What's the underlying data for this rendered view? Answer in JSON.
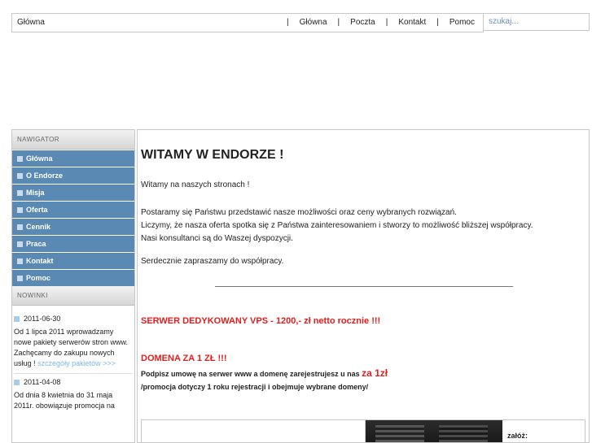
{
  "header": {
    "breadcrumb": "Główna",
    "nav": [
      "Główna",
      "Poczta",
      "Kontakt",
      "Pomoc"
    ],
    "search_placeholder": "szukaj..."
  },
  "sidebar": {
    "nav_title": "NAWIGATOR",
    "items": [
      "Główna",
      "O Endorze",
      "Misja",
      "Oferta",
      "Cennik",
      "Praca",
      "Kontakt",
      "Pomoc"
    ],
    "news_title": "NOWINKI",
    "news": [
      {
        "date": "2011-06-30",
        "text": "Od 1 lipca 2011 wprowadzamy nowe pakiety serwerów stron www. Zachęcamy do zakupu nowych usług !",
        "link": "szczegóły pakietów >>>"
      },
      {
        "date": "2011-04-08",
        "text": "Od dnia 8 kwietnia do 31 maja 2011r. obowiązuje promocja na"
      }
    ]
  },
  "main": {
    "title": "WITAMY W ENDORZE !",
    "intro": "Witamy na naszych stronach !",
    "para1": "Postaramy się Państwu przedstawić nasze możliwości oraz ceny wybranych rozwiązań.",
    "para2": "Liczymy, że nasza oferta spotka się z Państwa zainteresowaniem i stworzy to możliwość bliższej współpracy.",
    "para3": "Nasi konsultanci są do Waszej dyspozycji.",
    "closing": "Serdecznie zapraszamy do współpracy.",
    "promo1": "SERWER DEDYKOWANY VPS - 1200,- zł netto rocznie !!!",
    "promo2": "DOMENA ZA 1 ZŁ !!!",
    "promo2_line1_a": "Podpisz umowę na serwer www a domenę zarejestrujesz u nas",
    "promo2_line1_price": "za 1zł",
    "promo2_line2": "/promocja dotyczy 1 roku rejestracji i obejmuje wybrane domeny/",
    "box_label": "załóż:"
  }
}
